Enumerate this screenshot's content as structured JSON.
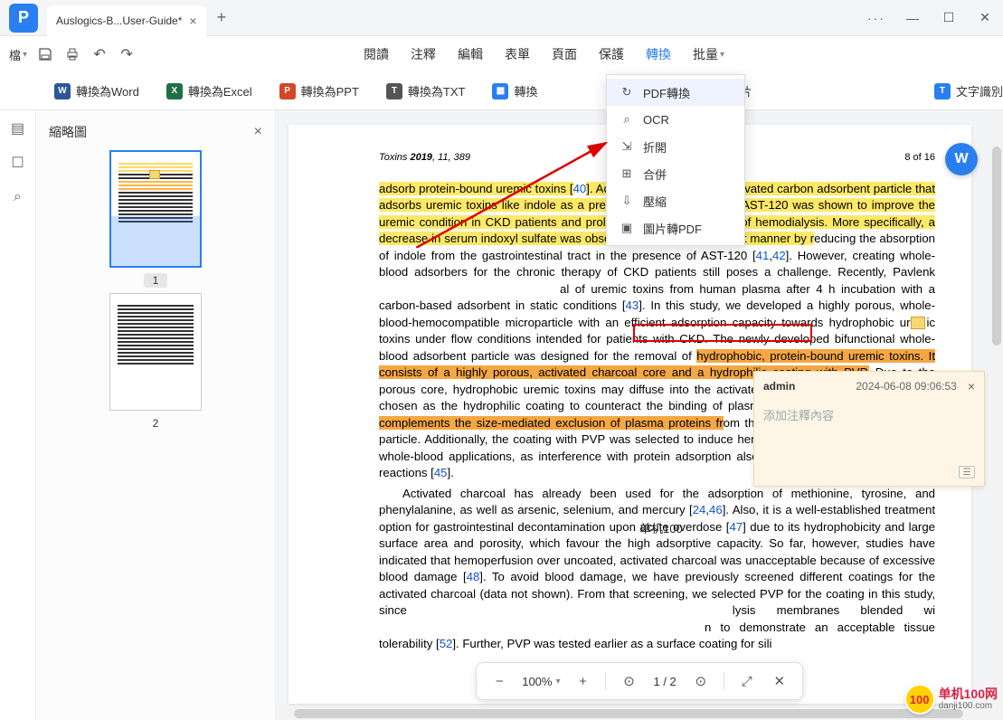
{
  "window": {
    "tab_title": "Auslogics-B...User-Guide*",
    "more": "···"
  },
  "file_menu": "檔",
  "main_menu": [
    "閱讀",
    "注釋",
    "編輯",
    "表單",
    "頁面",
    "保護",
    "轉換",
    "批量"
  ],
  "active_menu_index": 6,
  "convert_bar": [
    {
      "icon": "word",
      "label": "轉換為Word"
    },
    {
      "icon": "excel",
      "label": "轉換為Excel"
    },
    {
      "icon": "ppt",
      "label": "轉換為PPT"
    },
    {
      "icon": "txt",
      "label": "轉換為TXT"
    },
    {
      "icon": "img",
      "label": "轉換"
    },
    {
      "icon": "conv",
      "label": "片"
    },
    {
      "icon": "ocr",
      "label": "文字識別"
    }
  ],
  "dropdown": [
    {
      "icon": "↻",
      "label": "PDF轉換"
    },
    {
      "icon": "⌕",
      "label": "OCR"
    },
    {
      "icon": "⇲",
      "label": "折開"
    },
    {
      "icon": "⊞",
      "label": "合併"
    },
    {
      "icon": "⇩",
      "label": "壓縮"
    },
    {
      "icon": "▣",
      "label": "圖片轉PDF"
    }
  ],
  "sidebar": {
    "title": "縮略圖",
    "pages": [
      "1",
      "2"
    ]
  },
  "page_header": {
    "left_italic": "Toxins",
    "left_bold": "2019",
    "left_rest": ", 11, 389",
    "right": "8 of 16"
  },
  "doc": {
    "p1_pre": "adsorb protein-bound uremic toxins [",
    "ref40": "40",
    "p1_mid": "]. A",
    "p1_gap": "dministered, intestinal, activated carbon adsorbent particle that adsorbs uremic toxins like indole as a precursor of indoxyl sulfate. AST-120 was shown to improve the uremic condition in CKD patients and prolong the time to initiation of hemodialysis. More specifically, a decrease in serum indoxyl sulfate was observed in a dose-dependent manner by r",
    "p1_after": "educing the absorption of indole from the gastrointestinal tract in the presence of AST-120 [",
    "ref41": "41",
    "ref42": "42",
    "p1_tail1": "]. However, creating whole-blood adsorbers for the chronic therapy of CKD patients still poses a challenge. Recently, Pavlenk",
    "p1_tail2": "al of uremic toxins from human plasma after 4 h incubation with a carbon-based adsorbent in static conditions [",
    "ref43": "43",
    "p1_tail3": "]. In this study, we developed a highly porous, whole-blood-hemocompatible microparticle with an efficient adsorption capacity towards hydrophobic ur",
    "p1_tail4": "ic toxins under flow conditions intended for patients with CKD. The newly developed bifunctional whole-blood adsorbent particle was designed for the removal of ",
    "hl_o1": "hydrophobic, protein-bound uremic toxins. It consists of a highly porous, activated charcoal core and a hydrophilic coating with PVP.",
    "p1_tail5": " Due to the porous core, hydrophobic uremic toxins may diffuse into the activated charcoal core, while PVP was chosen as the hydrophilic coating to counteract the binding of plasma proteins and blood cells. ",
    "hl_o2": "This complements the size-mediated exclusion of plasma proteins fr",
    "p1_tail6": "om the particle by the pore size of the particle. Additionally, the coating with PVP was selected to induce hemocompatibility of the particles for whole-blood applications, as interference with protein adsorption also prevents downstream biological reactions [",
    "ref45": "45",
    "p1_end": "].",
    "p2_a": "Activated charcoal has already been used for the adsorption of methionine, tyrosine, and phenylalanine, as well as arsenic, selenium, and mercury [",
    "ref24": "24",
    "ref46": "46",
    "p2_b": "]. Also, it is a well-established treatment option for gastrointestinal decontamination upon acute overdose [",
    "ref47": "47",
    "p2_c": "] due to its hydrophobicity and large surface area and porosity, which favour the high adsorptive capacity. So far, however, studies have indicated that hemoperfusion over uncoated, activated charcoal was unacceptable because of excessive blood damage [",
    "ref48": "48",
    "p2_d": "]. To avoid blood damage, we have previously screened different coatings for the activated charcoal (data not shown). From that screening, we selected PVP for the coating in this study, since",
    "p2_e": "lysis membranes blended wi",
    "p2_f": "n to demonstrate an acceptable tissue tolerability [",
    "ref52": "52",
    "p2_g": "]. Further, PVP was tested earlier as a surface coating for sili"
  },
  "comment": {
    "user": "admin",
    "date": "2024-06-08 09:06:53",
    "placeholder": "添加注釋內容"
  },
  "bottom_bar": {
    "zoom": "100%",
    "page": "1 / 2"
  },
  "watermark": {
    "inline": "单机100",
    "brand": "单机100网",
    "url": "danji100.com",
    "ball": "100"
  }
}
